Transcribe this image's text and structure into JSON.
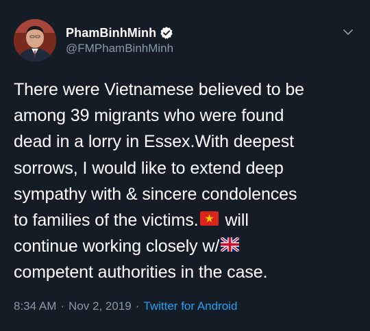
{
  "author": {
    "display_name": "PhamBinhMinh",
    "handle": "@FMPhamBinhMinh",
    "verified": true,
    "avatar_icon": "profile-photo-icon"
  },
  "tweet": {
    "lines": [
      "There were Vietnamese believed to be",
      "among 39 migrants who were found",
      "dead in a lorry in Essex.With deepest",
      "sorrows, I would like to extend deep",
      "sympathy with & sincere condolences"
    ],
    "line6_text": "to families of the victims.",
    "line6_flag": "vietnam-flag-icon",
    "line6_after": " will",
    "line7_text": "continue working closely w/",
    "line7_flag": "uk-flag-icon",
    "line8": "competent authorities in the case."
  },
  "meta": {
    "time": "8:34 AM",
    "separator": "·",
    "date": "Nov 2, 2019",
    "source": "Twitter for Android"
  },
  "colors": {
    "background": "#141d26",
    "text": "#ffffff",
    "secondary": "#8899a6",
    "link": "#1da1f2",
    "verified": "#ffffff"
  }
}
